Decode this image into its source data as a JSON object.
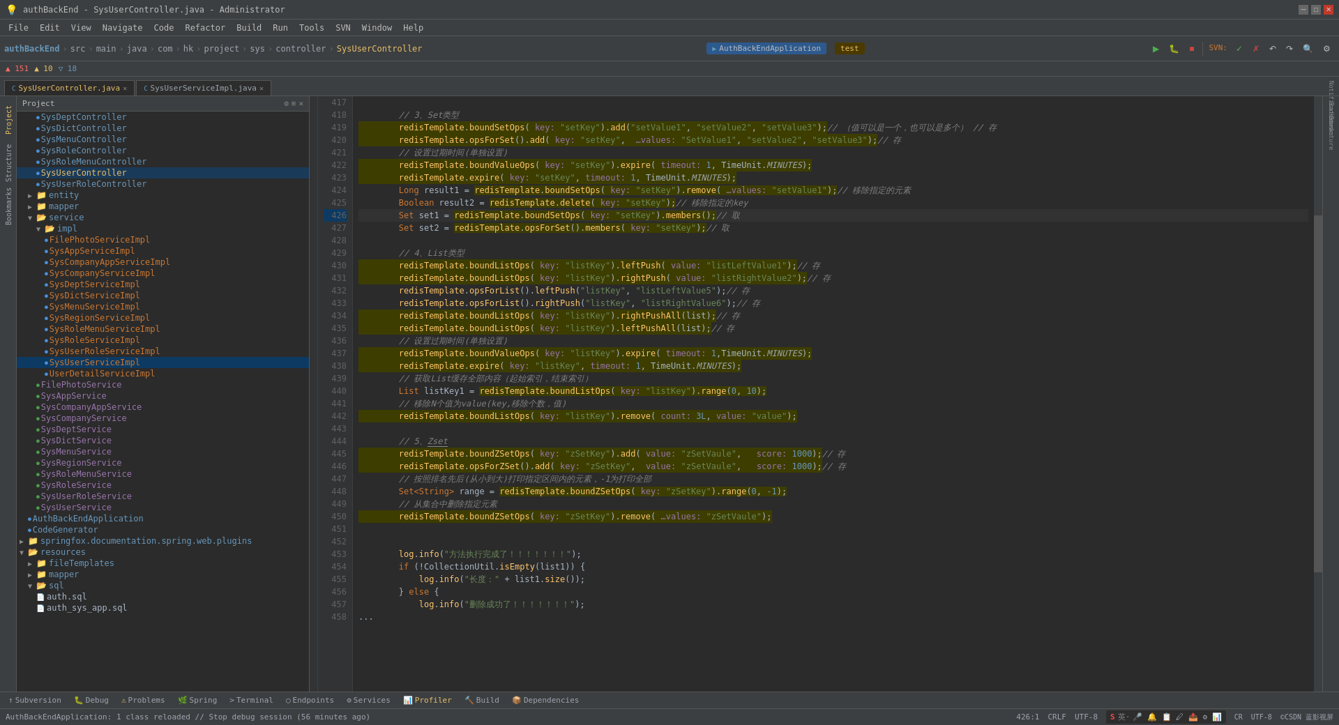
{
  "window": {
    "title": "authBackEnd - SysUserController.java - Administrator"
  },
  "menubar": {
    "items": [
      "File",
      "Edit",
      "View",
      "Navigate",
      "Code",
      "Refactor",
      "Build",
      "Run",
      "Tools",
      "SVN",
      "Window",
      "Help"
    ]
  },
  "toolbar": {
    "project": "authBackEnd",
    "breadcrumb": [
      "src",
      "main",
      "java",
      "com",
      "hk",
      "project",
      "sys",
      "controller",
      "SysUserController"
    ],
    "run_config": "AuthBackEndApplication",
    "test": "test"
  },
  "tabs": [
    {
      "label": "SysUserController.java",
      "active": true
    },
    {
      "label": "SysUserServiceImpl.java",
      "active": false
    }
  ],
  "svn_bar": {
    "errors": "▲ 151",
    "warnings": "▲ 10",
    "info": "▽ 18"
  },
  "sidebar": {
    "header": "Project",
    "items": [
      {
        "indent": 2,
        "type": "class",
        "label": "SysDeptController",
        "color": "controller"
      },
      {
        "indent": 2,
        "type": "class",
        "label": "SysDictController",
        "color": "controller"
      },
      {
        "indent": 2,
        "type": "class",
        "label": "SysMenuController",
        "color": "controller"
      },
      {
        "indent": 2,
        "type": "class",
        "label": "SysRoleController",
        "color": "controller"
      },
      {
        "indent": 2,
        "type": "class",
        "label": "SysRoleMenuController",
        "color": "controller"
      },
      {
        "indent": 2,
        "type": "class",
        "label": "SysUserController",
        "color": "highlighted"
      },
      {
        "indent": 2,
        "type": "class",
        "label": "SysUserRoleController",
        "color": "controller"
      },
      {
        "indent": 1,
        "type": "folder",
        "label": "entity",
        "arrow": "▶"
      },
      {
        "indent": 1,
        "type": "folder",
        "label": "mapper",
        "arrow": "▶"
      },
      {
        "indent": 1,
        "type": "folder",
        "label": "service",
        "arrow": "▼",
        "open": true
      },
      {
        "indent": 2,
        "type": "folder",
        "label": "impl",
        "arrow": "▼",
        "open": true
      },
      {
        "indent": 3,
        "type": "class",
        "label": "FilePhotoServiceImpl",
        "color": "impl"
      },
      {
        "indent": 3,
        "type": "class",
        "label": "SysAppServiceImpl",
        "color": "impl"
      },
      {
        "indent": 3,
        "type": "class",
        "label": "SysCompanyAppServiceImpl",
        "color": "impl"
      },
      {
        "indent": 3,
        "type": "class",
        "label": "SysCompanyServiceImpl",
        "color": "impl"
      },
      {
        "indent": 3,
        "type": "class",
        "label": "SysDeptServiceImpl",
        "color": "impl"
      },
      {
        "indent": 3,
        "type": "class",
        "label": "SysDictServiceImpl",
        "color": "impl"
      },
      {
        "indent": 3,
        "type": "class",
        "label": "SysMenuServiceImpl",
        "color": "impl"
      },
      {
        "indent": 3,
        "type": "class",
        "label": "SysRegionServiceImpl",
        "color": "impl"
      },
      {
        "indent": 3,
        "type": "class",
        "label": "SysRoleMenuServiceImpl",
        "color": "impl"
      },
      {
        "indent": 3,
        "type": "class",
        "label": "SysRoleServiceImpl",
        "color": "impl"
      },
      {
        "indent": 3,
        "type": "class",
        "label": "SysUserRoleServiceImpl",
        "color": "impl"
      },
      {
        "indent": 3,
        "type": "class",
        "label": "SysUserServiceImpl",
        "color": "impl",
        "selected": true
      },
      {
        "indent": 3,
        "type": "class",
        "label": "UserDetailServiceImpl",
        "color": "impl"
      },
      {
        "indent": 2,
        "type": "interface",
        "label": "FilePhotoService",
        "color": "interface"
      },
      {
        "indent": 2,
        "type": "interface",
        "label": "SysAppService",
        "color": "interface"
      },
      {
        "indent": 2,
        "type": "interface",
        "label": "SysCompanyAppService",
        "color": "interface"
      },
      {
        "indent": 2,
        "type": "interface",
        "label": "SysCompanyService",
        "color": "interface"
      },
      {
        "indent": 2,
        "type": "interface",
        "label": "SysDeptService",
        "color": "interface"
      },
      {
        "indent": 2,
        "type": "interface",
        "label": "SysDictService",
        "color": "interface"
      },
      {
        "indent": 2,
        "type": "interface",
        "label": "SysMenuService",
        "color": "interface"
      },
      {
        "indent": 2,
        "type": "interface",
        "label": "SysRegionService",
        "color": "interface"
      },
      {
        "indent": 2,
        "type": "interface",
        "label": "SysRoleMenuService",
        "color": "interface"
      },
      {
        "indent": 2,
        "type": "interface",
        "label": "SysRoleService",
        "color": "interface"
      },
      {
        "indent": 2,
        "type": "interface",
        "label": "SysUserRoleService",
        "color": "interface"
      },
      {
        "indent": 2,
        "type": "interface",
        "label": "SysUserService",
        "color": "interface"
      },
      {
        "indent": 1,
        "type": "class",
        "label": "AuthBackEndApplication",
        "color": "controller"
      },
      {
        "indent": 1,
        "type": "class",
        "label": "CodeGenerator",
        "color": "controller"
      },
      {
        "indent": 0,
        "type": "folder",
        "label": "springfox.documentation.spring.web.plugins",
        "arrow": "▶"
      },
      {
        "indent": 0,
        "type": "folder",
        "label": "resources",
        "arrow": "▼",
        "open": true
      },
      {
        "indent": 1,
        "type": "folder",
        "label": "fileTemplates",
        "arrow": "▶"
      },
      {
        "indent": 1,
        "type": "folder",
        "label": "mapper",
        "arrow": "▶"
      },
      {
        "indent": 1,
        "type": "folder",
        "label": "sql",
        "arrow": "▼",
        "open": true
      },
      {
        "indent": 2,
        "type": "file",
        "label": "auth.sql"
      },
      {
        "indent": 2,
        "type": "file",
        "label": "auth_sys_app.sql"
      }
    ]
  },
  "code": {
    "lines": [
      {
        "num": 417,
        "content": ""
      },
      {
        "num": 418,
        "content": "        // 3、Set类型"
      },
      {
        "num": 419,
        "content": "        redisTemplate.boundSetOps( key: \"setKey\").add(\"setValue1\", \"setValue2\", \"setValue3\");// （值可以是一个，也可以是多个） // 存"
      },
      {
        "num": 420,
        "content": "        redisTemplate.opsForSet().add( key: \"setKey\",  …values: \"SetValue1\", \"setValue2\", \"setValue3\");// 存"
      },
      {
        "num": 421,
        "content": "        // 设置过期时间(单独设置)"
      },
      {
        "num": 422,
        "content": "        redisTemplate.boundValueOps( key: \"setKey\").expire( timeout: 1, TimeUnit.MINUTES);"
      },
      {
        "num": 423,
        "content": "        redisTemplate.expire( key: \"setKey\", timeout: 1, TimeUnit.MINUTES);"
      },
      {
        "num": 424,
        "content": "        Long result1 = redisTemplate.boundSetOps( key: \"setKey\").remove( …values: \"setValue1\");// 移除指定的元素"
      },
      {
        "num": 425,
        "content": "        Boolean result2 = redisTemplate.delete( key: \"setKey\");// 移除指定的key"
      },
      {
        "num": 426,
        "content": "        Set set1 = redisTemplate.boundSetOps( key: \"setKey\").members();// 取"
      },
      {
        "num": 427,
        "content": "        Set set2 = redisTemplate.opsForSet().members( key: \"setKey\");// 取"
      },
      {
        "num": 428,
        "content": ""
      },
      {
        "num": 429,
        "content": "        // 4、List类型"
      },
      {
        "num": 430,
        "content": "        redisTemplate.boundListOps( key: \"listKey\").leftPush( value: \"listLeftValue1\");// 存"
      },
      {
        "num": 431,
        "content": "        redisTemplate.boundListOps( key: \"listKey\").rightPush( value: \"listRightValue2\");// 存"
      },
      {
        "num": 432,
        "content": "        redisTemplate.opsForList().leftPush(\"listKey\", \"listLeftValue5\");// 存"
      },
      {
        "num": 433,
        "content": "        redisTemplate.opsForList().rightPush(\"listKey\", \"listRightValue6\");// 存"
      },
      {
        "num": 434,
        "content": "        redisTemplate.boundListOps( key: \"listKey\").rightPushAll(list);// 存"
      },
      {
        "num": 435,
        "content": "        redisTemplate.boundListOps( key: \"listKey\").leftPushAll(list);// 存"
      },
      {
        "num": 436,
        "content": "        // 设置过期时间(单独设置)"
      },
      {
        "num": 437,
        "content": "        redisTemplate.boundValueOps( key: \"listKey\").expire( timeout: 1,TimeUnit.MINUTES);"
      },
      {
        "num": 438,
        "content": "        redisTemplate.expire( key: \"listKey\", timeout: 1, TimeUnit.MINUTES);"
      },
      {
        "num": 439,
        "content": "        // 获取List缓存全部内容（起始索引，结束索引）"
      },
      {
        "num": 440,
        "content": "        List listKey1 = redisTemplate.boundListOps( key: \"listKey\").range(0, 10);"
      },
      {
        "num": 441,
        "content": "        // 移除N个值为value(key,移除个数，值)"
      },
      {
        "num": 442,
        "content": "        redisTemplate.boundListOps( key: \"listKey\").remove( count: 3L, value: \"value\");"
      },
      {
        "num": 443,
        "content": ""
      },
      {
        "num": 444,
        "content": "        // 5、Zset"
      },
      {
        "num": 445,
        "content": "        redisTemplate.boundZSetOps( key: \"zSetKey\").add( value: \"zSetVaule\",   score: 1000);// 存"
      },
      {
        "num": 446,
        "content": "        redisTemplate.opsForZSet().add( key: \"zSetKey\",  value: \"zSetVaule\",   score: 1000);// 存"
      },
      {
        "num": 447,
        "content": "        // 按照排名先后(从小到大)打印指定区间内的元素，-1为打印全部"
      },
      {
        "num": 448,
        "content": "        Set<String> range = redisTemplate.boundZSetOps( key: \"zSetKey\").range(0, -1);"
      },
      {
        "num": 449,
        "content": "        // 从集合中删除指定元素"
      },
      {
        "num": 450,
        "content": "        redisTemplate.boundZSetOps( key: \"zSetKey\").remove( …values: \"zSetVaule\");"
      },
      {
        "num": 451,
        "content": ""
      },
      {
        "num": 452,
        "content": ""
      },
      {
        "num": 453,
        "content": "        log.info(\"方法执行完成了！！！！！！！\");"
      },
      {
        "num": 454,
        "content": "        if (!CollectionUtil.isEmpty(list1)) {"
      },
      {
        "num": 455,
        "content": "            log.info(\"长度：\" + list1.size());"
      },
      {
        "num": 456,
        "content": "        } else {"
      },
      {
        "num": 457,
        "content": "            log.info(\"删除成功了！！！！！！！\");"
      },
      {
        "num": 458,
        "content": "..."
      }
    ]
  },
  "status_bar": {
    "left": "AuthBackEndApplication: 1 class reloaded // Stop debug session (56 minutes ago)",
    "position": "426:1",
    "encoding": "CRLF",
    "charset": "UTF-8",
    "right": ""
  },
  "bottom_tabs": [
    {
      "label": "Subversion",
      "icon": "↑"
    },
    {
      "label": "Debug",
      "icon": "🐛"
    },
    {
      "label": "Problems",
      "icon": "⚠"
    },
    {
      "label": "Spring",
      "icon": "🌿"
    },
    {
      "label": "Terminal",
      "icon": ">"
    },
    {
      "label": "Endpoints",
      "icon": "○"
    },
    {
      "label": "Services",
      "icon": "⚙"
    },
    {
      "label": "Profiler",
      "icon": "📊",
      "active": true
    },
    {
      "label": "Build",
      "icon": "🔨"
    },
    {
      "label": "Dependencies",
      "icon": "📦"
    }
  ],
  "right_panels": [
    "Notifications",
    "Bookmarks",
    "Structure"
  ]
}
